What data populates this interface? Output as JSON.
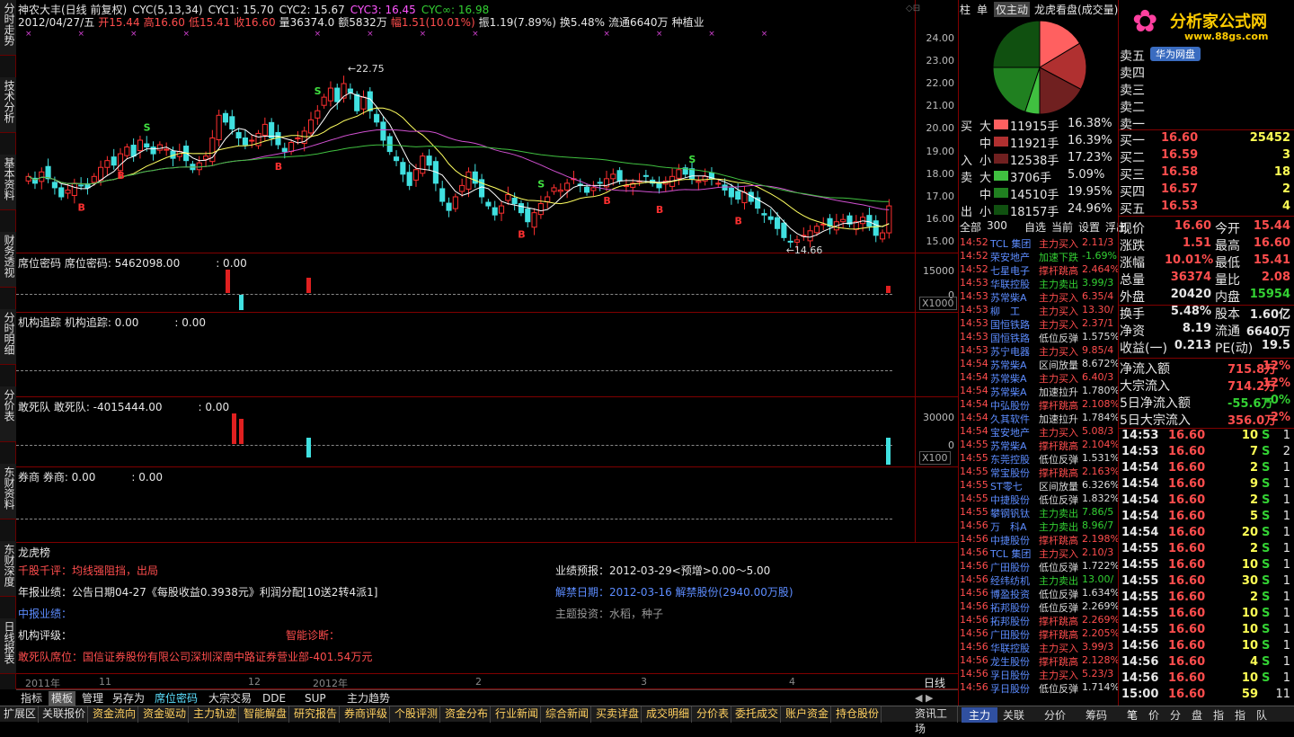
{
  "left_tabs": [
    "分时走势",
    "技术分析",
    "基本资料",
    "财务透视",
    "分时明细",
    "分价表",
    "东财资料",
    "东财深度",
    "日线报表"
  ],
  "header": {
    "line1": [
      {
        "t": "神农大丰(日线 前复权)",
        "c": "w"
      },
      {
        "t": "CYC(5,13,34)",
        "c": "w"
      },
      {
        "t": "CYC1: 15.70",
        "c": "w"
      },
      {
        "t": "CYC2: 15.67",
        "c": "w"
      },
      {
        "t": "CYC3: 16.45",
        "c": "m"
      },
      {
        "t": "CYC∞: 16.98",
        "c": "g"
      }
    ],
    "line2": [
      {
        "t": "2012/04/27/五",
        "c": "w"
      },
      {
        "t": "开15.44",
        "c": "r"
      },
      {
        "t": "高16.60",
        "c": "r"
      },
      {
        "t": "低15.41",
        "c": "r"
      },
      {
        "t": "收16.60",
        "c": "r"
      },
      {
        "t": "量36374.0",
        "c": "w"
      },
      {
        "t": "额5832万",
        "c": "w"
      },
      {
        "t": "幅1.51(10.01%)",
        "c": "r"
      },
      {
        "t": "振1.19(7.89%)",
        "c": "w"
      },
      {
        "t": "换5.48%",
        "c": "w"
      },
      {
        "t": "流通6640万",
        "c": "w"
      },
      {
        "t": "种植业",
        "c": "w"
      }
    ]
  },
  "main_axis": [
    "24.00",
    "23.00",
    "22.00",
    "21.00",
    "20.00",
    "19.00",
    "18.00",
    "17.00",
    "16.00",
    "15.00"
  ],
  "annotations": {
    "high": "22.75",
    "low": "14.66"
  },
  "signals": {
    "buy": "B",
    "sell": "S"
  },
  "panes": [
    {
      "name": "席位密码",
      "title": "席位密码 席位密码: 5462098.00",
      "extra": ": 0.00",
      "ticks": [
        "15000",
        "0"
      ],
      "mult": "X1000"
    },
    {
      "name": "机构追踪",
      "title": "机构追踪 机构追踪: 0.00",
      "extra": ": 0.00"
    },
    {
      "name": "敢死队",
      "title": "敢死队 敢死队: -4015444.00",
      "extra": ": 0.00",
      "ticks": [
        "30000",
        "0"
      ],
      "mult": "X100"
    },
    {
      "name": "券商",
      "title": "券商 券商: 0.00",
      "extra": ": 0.00"
    }
  ],
  "info": {
    "title": "龙虎榜",
    "comment": "千股千评：均线强阻挡，出局",
    "annual": "年报业绩：公告日期04-27《每股收益0.3938元》利润分配[10送2转4派1]",
    "interim": "中报业绩：",
    "rating": "机构评级：",
    "diagnosis": "智能诊断：",
    "dare": "敢死队席位：国信证券股份有限公司深圳深南中路证券营业部-401.54万元",
    "forecast": "业绩预报：2012-03-29<预增>0.00～5.00",
    "unlock": "解禁日期：2012-03-16 解禁股份(2940.00万股)",
    "theme": "主题投资：水稻，种子"
  },
  "time_axis": [
    "2011年",
    "11",
    "12",
    "2012年",
    "2",
    "3",
    "4"
  ],
  "period": "日线",
  "bottom_tabs": [
    "指标",
    "模板",
    "管理",
    "另存为",
    "席位密码",
    "大宗交易",
    "DDE",
    "SUP",
    "主力趋势"
  ],
  "bottom_bar": [
    "扩展区",
    "关联报价",
    "资金流向",
    "资金驱动",
    "主力轨迹",
    "智能解盘",
    "研究报告",
    "券商评级",
    "个股评测",
    "资金分布",
    "行业新闻",
    "综合新闻",
    "买卖详盘",
    "成交明细",
    "分价表",
    "委托成交",
    "账户资金",
    "持仓股份",
    "资讯工场"
  ],
  "right": {
    "top_tabs": [
      "柱",
      "单",
      "仅主动",
      "龙虎看盘(成交量)"
    ],
    "logo": "分析家公式网",
    "logo_url": "www.88gs.com",
    "badge": "华为网盘",
    "flow_rows": [
      {
        "side": "买",
        "size": "大",
        "vol": "11915手",
        "pct": "16.38%",
        "col": "#ff6060"
      },
      {
        "side": "",
        "size": "中",
        "vol": "11921手",
        "pct": "16.39%",
        "col": "#b03030"
      },
      {
        "side": "入",
        "size": "小",
        "vol": "12538手",
        "pct": "17.23%",
        "col": "#702020"
      },
      {
        "side": "卖",
        "size": "大",
        "vol": "3706手",
        "pct": "5.09%",
        "col": "#40c040"
      },
      {
        "side": "",
        "size": "中",
        "vol": "14510手",
        "pct": "19.95%",
        "col": "#208020"
      },
      {
        "side": "出",
        "size": "小",
        "vol": "18157手",
        "pct": "24.96%",
        "col": "#105010"
      }
    ],
    "pie": [
      16.38,
      16.39,
      17.23,
      5.09,
      19.95,
      24.96
    ],
    "sell_labels": [
      "卖五",
      "卖四",
      "卖三",
      "卖二",
      "卖一"
    ],
    "bids": [
      [
        "买一",
        "16.60",
        "25452"
      ],
      [
        "买二",
        "16.59",
        "3"
      ],
      [
        "买三",
        "16.58",
        "18"
      ],
      [
        "买四",
        "16.57",
        "2"
      ],
      [
        "买五",
        "16.53",
        "4"
      ]
    ],
    "stats": [
      [
        "现价",
        "16.60",
        "今开",
        "15.44"
      ],
      [
        "涨跌",
        "1.51",
        "最高",
        "16.60"
      ],
      [
        "涨幅",
        "10.01%",
        "最低",
        "15.41"
      ],
      [
        "总量",
        "36374",
        "量比",
        "2.08"
      ],
      [
        "外盘",
        "20420",
        "内盘",
        "15954"
      ],
      [
        "换手",
        "5.48%",
        "股本",
        "1.60亿"
      ],
      [
        "净资",
        "8.19",
        "流通",
        "6640万"
      ],
      [
        "收益(一)",
        "0.213",
        "PE(动)",
        "19.5"
      ]
    ],
    "flows": [
      [
        "净流入额",
        "715.8万",
        "12%"
      ],
      [
        "大宗流入",
        "714.2万",
        "12%"
      ],
      [
        "5日净流入额",
        "-55.6万",
        "-0%"
      ],
      [
        "5日大宗流入",
        "356.0万",
        "2%"
      ]
    ],
    "ticks": [
      [
        "14:53",
        "16.60",
        "10",
        "S",
        "1"
      ],
      [
        "14:53",
        "16.60",
        "7",
        "S",
        "2"
      ],
      [
        "14:54",
        "16.60",
        "2",
        "S",
        "1"
      ],
      [
        "14:54",
        "16.60",
        "9",
        "S",
        "1"
      ],
      [
        "14:54",
        "16.60",
        "2",
        "S",
        "1"
      ],
      [
        "14:54",
        "16.60",
        "5",
        "S",
        "1"
      ],
      [
        "14:54",
        "16.60",
        "20",
        "S",
        "1"
      ],
      [
        "14:55",
        "16.60",
        "2",
        "S",
        "1"
      ],
      [
        "14:55",
        "16.60",
        "10",
        "S",
        "1"
      ],
      [
        "14:55",
        "16.60",
        "30",
        "S",
        "1"
      ],
      [
        "14:55",
        "16.60",
        "2",
        "S",
        "1"
      ],
      [
        "14:55",
        "16.60",
        "10",
        "S",
        "1"
      ],
      [
        "14:55",
        "16.60",
        "10",
        "S",
        "1"
      ],
      [
        "14:56",
        "16.60",
        "10",
        "S",
        "1"
      ],
      [
        "14:56",
        "16.60",
        "4",
        "S",
        "1"
      ],
      [
        "14:56",
        "16.60",
        "10",
        "S",
        "1"
      ],
      [
        "15:00",
        "16.60",
        "59",
        "",
        "11"
      ]
    ],
    "list_tabs": [
      "全部",
      "300",
      "自选",
      "当前",
      "设置",
      "浮出"
    ],
    "radar": [
      [
        "14:52",
        "TCL 集团",
        "主力买入",
        "2.11/3"
      ],
      [
        "14:52",
        "荣安地产",
        "加速下跌",
        "-1.69%"
      ],
      [
        "14:52",
        "七星电子",
        "撑杆跳高",
        "2.464%"
      ],
      [
        "14:53",
        "华联控股",
        "主力卖出",
        "3.99/3"
      ],
      [
        "14:53",
        "苏常柴A",
        "主力买入",
        "6.35/4"
      ],
      [
        "14:53",
        "柳　工",
        "主力买入",
        "13.30/"
      ],
      [
        "14:53",
        "国恒铁路",
        "主力买入",
        "2.37/1"
      ],
      [
        "14:53",
        "国恒铁路",
        "低位反弹",
        "1.575%"
      ],
      [
        "14:53",
        "苏宁电器",
        "主力买入",
        "9.85/4"
      ],
      [
        "14:54",
        "苏常柴A",
        "区间放量",
        "8.672%"
      ],
      [
        "14:54",
        "苏常柴A",
        "主力买入",
        "6.40/3"
      ],
      [
        "14:54",
        "苏常柴A",
        "加速拉升",
        "1.780%"
      ],
      [
        "14:54",
        "中弘股份",
        "撑杆跳高",
        "2.108%"
      ],
      [
        "14:54",
        "久其软件",
        "加速拉升",
        "1.784%"
      ],
      [
        "14:54",
        "宝安地产",
        "主力买入",
        "5.08/3"
      ],
      [
        "14:55",
        "苏常柴A",
        "撑杆跳高",
        "2.104%"
      ],
      [
        "14:55",
        "东莞控股",
        "低位反弹",
        "1.531%"
      ],
      [
        "14:55",
        "常宝股份",
        "撑杆跳高",
        "2.163%"
      ],
      [
        "14:55",
        "ST零七",
        "区间放量",
        "6.326%"
      ],
      [
        "14:55",
        "中捷股份",
        "低位反弹",
        "1.832%"
      ],
      [
        "14:55",
        "攀钢钒钛",
        "主力卖出",
        "7.86/5"
      ],
      [
        "14:56",
        "万　科A",
        "主力卖出",
        "8.96/7"
      ],
      [
        "14:56",
        "中捷股份",
        "撑杆跳高",
        "2.198%"
      ],
      [
        "14:56",
        "TCL 集团",
        "主力买入",
        "2.10/3"
      ],
      [
        "14:56",
        "广田股份",
        "低位反弹",
        "1.722%"
      ],
      [
        "14:56",
        "经纬纺机",
        "主力卖出",
        "13.00/"
      ],
      [
        "14:56",
        "博盈投资",
        "低位反弹",
        "1.634%"
      ],
      [
        "14:56",
        "拓邦股份",
        "低位反弹",
        "2.269%"
      ],
      [
        "14:56",
        "拓邦股份",
        "撑杆跳高",
        "2.269%"
      ],
      [
        "14:56",
        "广田股份",
        "撑杆跳高",
        "2.205%"
      ],
      [
        "14:56",
        "华联控股",
        "主力买入",
        "3.99/3"
      ],
      [
        "14:56",
        "龙生股份",
        "撑杆跳高",
        "2.128%"
      ],
      [
        "14:56",
        "孚日股份",
        "主力买入",
        "5.23/3"
      ],
      [
        "14:56",
        "孚日股份",
        "低位反弹",
        "1.714%"
      ]
    ],
    "footer_tabs": [
      "主力",
      "关联",
      "分价",
      "筹码",
      "笔",
      "价",
      "分",
      "盘",
      "指",
      "指",
      "队"
    ]
  },
  "chart_data": {
    "type": "candlestick",
    "title": "神农大丰(日线 前复权)",
    "ylim": [
      14.5,
      24.5
    ],
    "close": [
      17.9,
      17.6,
      18.1,
      17.8,
      17.4,
      17.0,
      17.3,
      17.6,
      17.5,
      17.4,
      17.9,
      18.3,
      18.6,
      18.4,
      18.9,
      19.2,
      18.8,
      19.5,
      19.2,
      18.9,
      19.3,
      19.1,
      18.7,
      19.0,
      18.6,
      18.2,
      18.5,
      18.8,
      19.6,
      20.6,
      20.3,
      20.0,
      19.6,
      19.3,
      19.5,
      19.8,
      20.2,
      19.6,
      19.3,
      19.0,
      19.4,
      19.6,
      19.9,
      20.4,
      20.8,
      21.4,
      21.8,
      21.2,
      22.0,
      21.6,
      20.8,
      21.4,
      20.8,
      20.3,
      19.5,
      19.0,
      18.6,
      18.0,
      17.5,
      18.2,
      18.8,
      18.4,
      17.6,
      16.8,
      16.4,
      17.0,
      17.5,
      18.1,
      17.6,
      17.0,
      16.6,
      16.2,
      16.6,
      17.1,
      16.7,
      16.3,
      15.9,
      16.3,
      16.7,
      17.0,
      17.4,
      17.3,
      17.6,
      17.8,
      17.5,
      17.2,
      17.4,
      17.6,
      17.8,
      18.0,
      17.7,
      17.5,
      17.6,
      17.7,
      17.9,
      17.6,
      17.4,
      17.7,
      17.9,
      18.2,
      18.0,
      17.8,
      17.7,
      17.9,
      17.8,
      17.6,
      17.3,
      17.0,
      16.9,
      17.2,
      16.8,
      16.5,
      16.2,
      16.0,
      15.6,
      15.2,
      15.0,
      15.1,
      15.3,
      15.5,
      15.7,
      15.8,
      15.7,
      15.9,
      16.0,
      15.8,
      15.9,
      16.1,
      15.7,
      15.3,
      15.41,
      16.6
    ],
    "ma_lines": [
      "CYC1",
      "CYC2",
      "CYC3",
      "CYC∞"
    ]
  }
}
